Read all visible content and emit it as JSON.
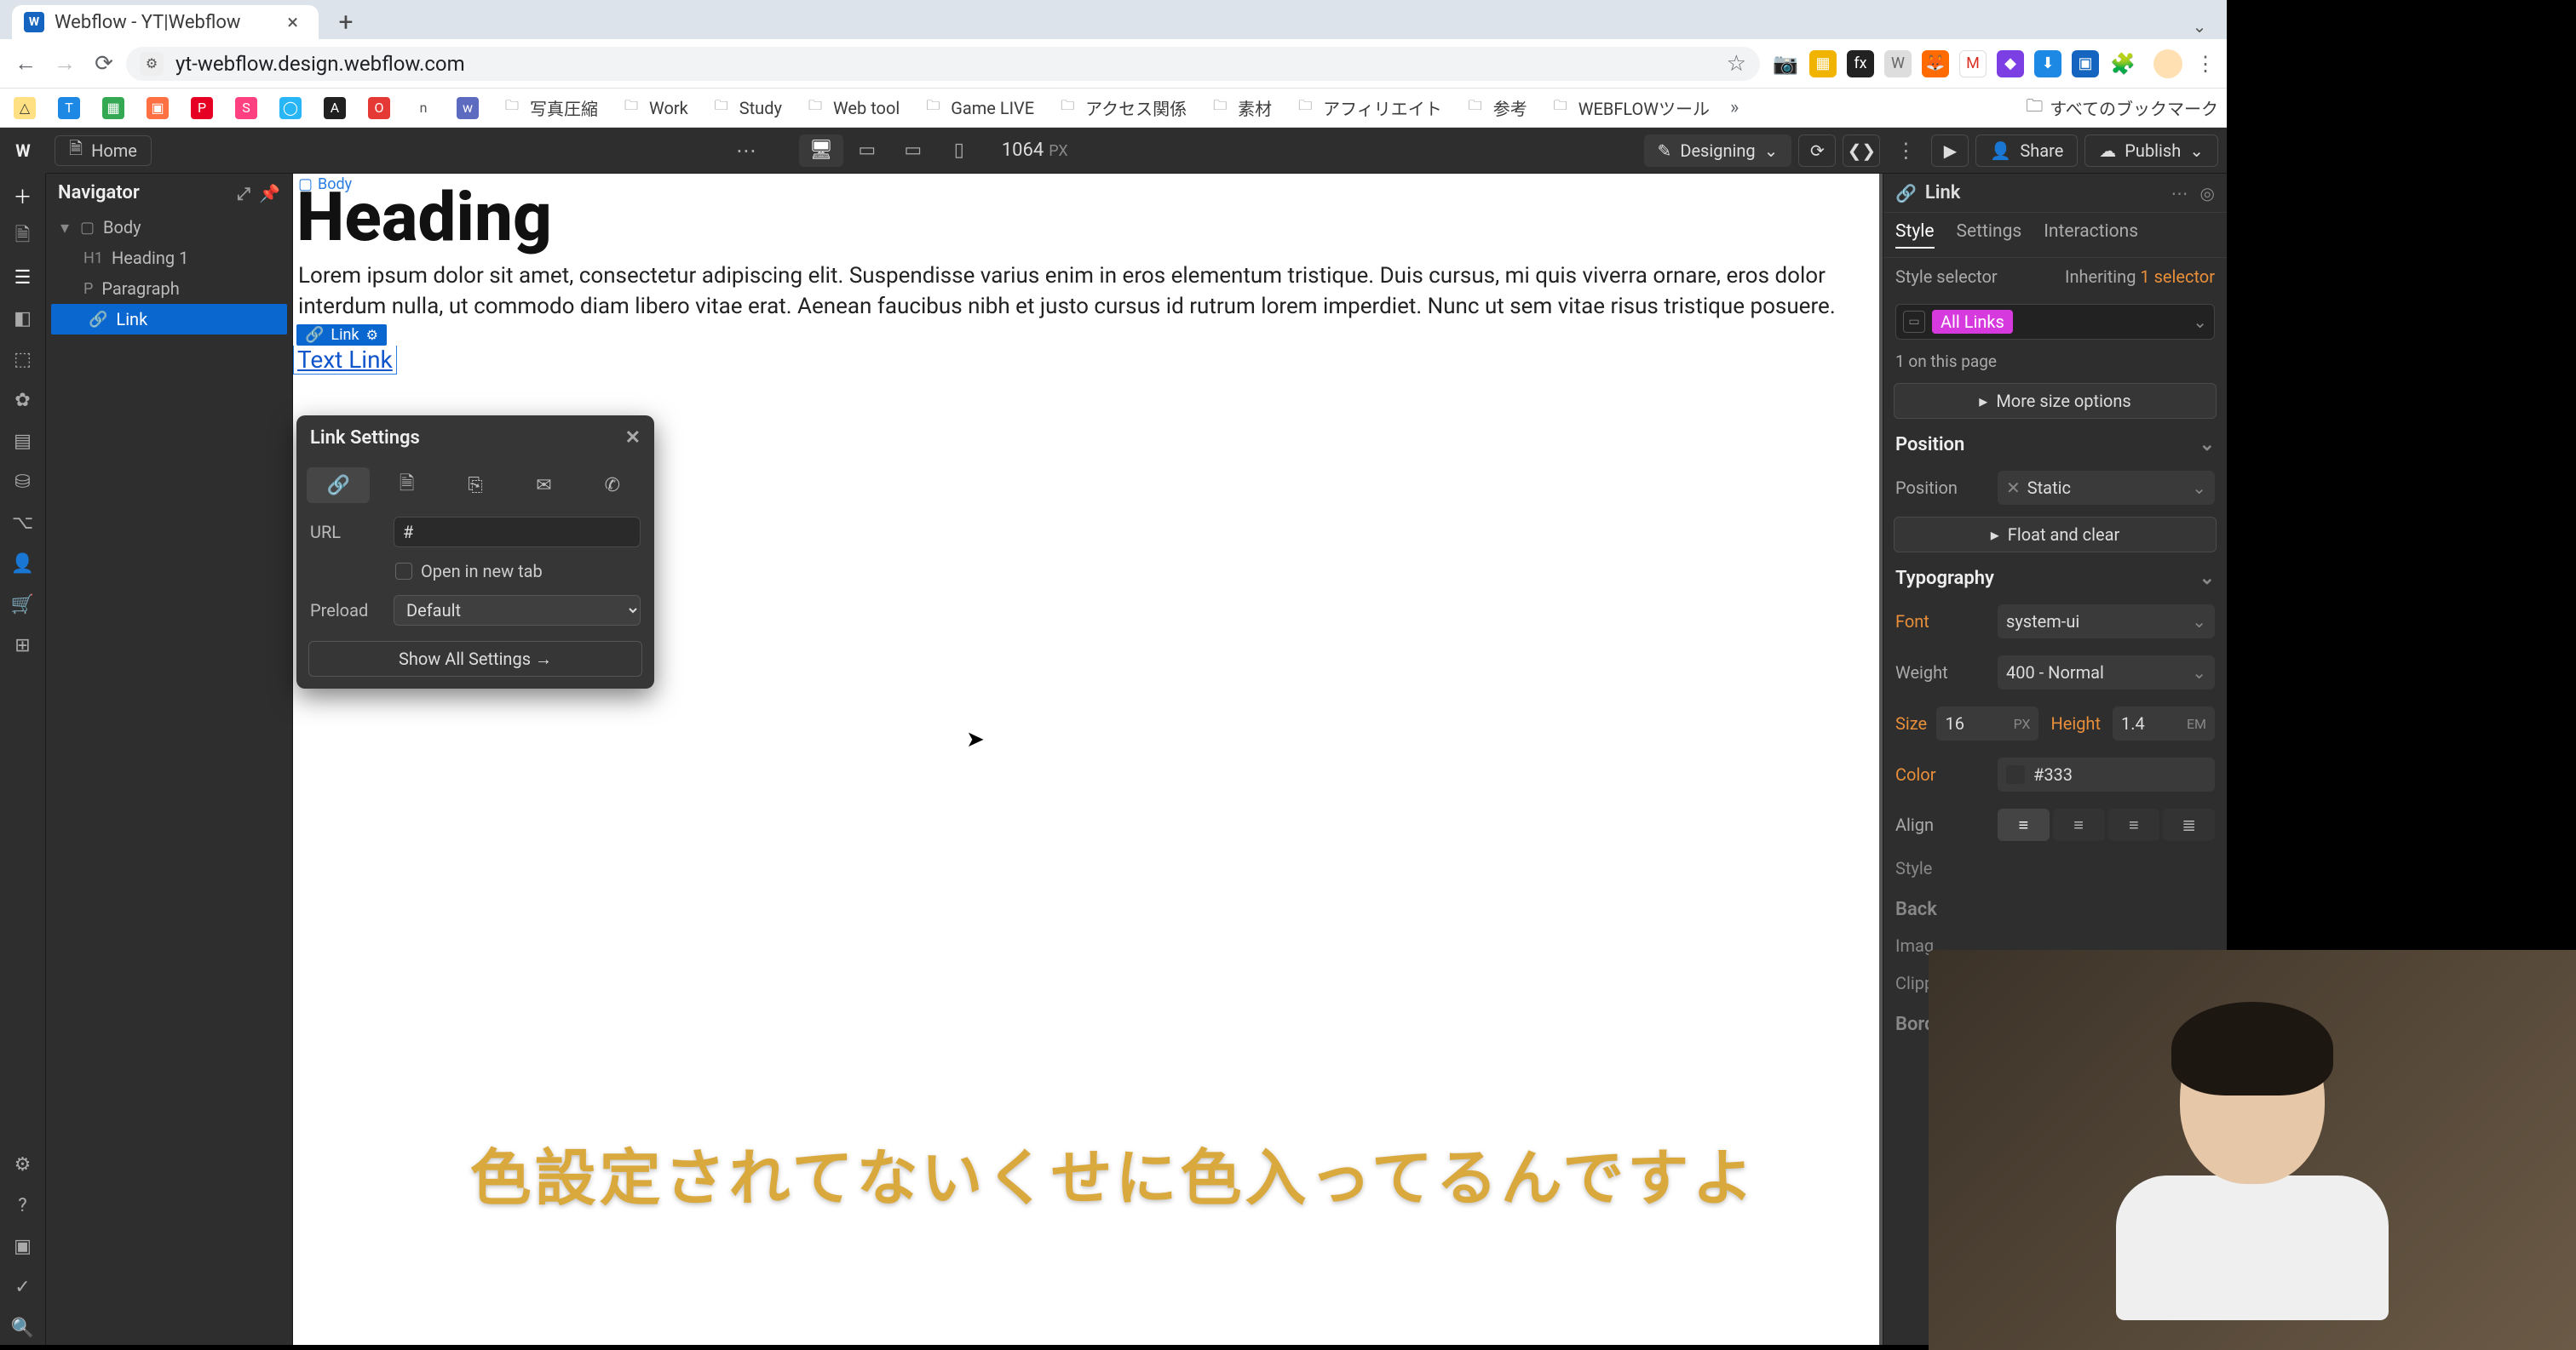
{
  "browser": {
    "tab_title": "Webflow - YT|Webflow",
    "url": "yt-webflow.design.webflow.com",
    "new_tab_tip": "+",
    "bookmarks": [
      {
        "icon": "drive",
        "color": "#f4b400",
        "label": ""
      },
      {
        "icon": "t",
        "color": "#1e88e5",
        "label": ""
      },
      {
        "icon": "g",
        "color": "#34a853",
        "label": ""
      },
      {
        "icon": "sq",
        "color": "#ff7043",
        "label": ""
      },
      {
        "icon": "p",
        "color": "#e60023",
        "label": ""
      },
      {
        "icon": "s",
        "color": "#ff4081",
        "label": ""
      },
      {
        "icon": "c",
        "color": "#29b6f6",
        "label": ""
      },
      {
        "icon": "a",
        "color": "#212121",
        "label": ""
      },
      {
        "icon": "o",
        "color": "#e53935",
        "label": ""
      },
      {
        "icon": "n",
        "color": "#757575",
        "label": ""
      },
      {
        "icon": "w",
        "color": "#5c6bc0",
        "label": ""
      }
    ],
    "folders": [
      "写真圧縮",
      "Work",
      "Study",
      "Web tool",
      "Game LIVE",
      "アクセス関係",
      "素材",
      "アフィリエイト",
      "参考",
      "WEBFLOWツール"
    ],
    "all_bookmarks": "すべてのブックマーク"
  },
  "webflow": {
    "home": "Home",
    "canvas_width": "1064",
    "canvas_unit": "PX",
    "designing": "Designing",
    "share": "Share",
    "publish": "Publish"
  },
  "navigator": {
    "title": "Navigator",
    "items": {
      "body": "Body",
      "h1": "Heading 1",
      "p": "Paragraph",
      "link": "Link"
    }
  },
  "canvas": {
    "body_chip": "Body",
    "heading": "Heading",
    "paragraph": "Lorem ipsum dolor sit amet, consectetur adipiscing elit. Suspendisse varius enim in eros elementum tristique. Duis cursus, mi quis viverra ornare, eros dolor interdum nulla, ut commodo diam libero vitae erat. Aenean faucibus nibh et justo cursus id rutrum lorem imperdiet. Nunc ut sem vitae risus tristique posuere.",
    "sel_chip": "Link",
    "text_link": "Text Link"
  },
  "link_settings": {
    "title": "Link Settings",
    "url_label": "URL",
    "url_value": "#",
    "open_new_tab": "Open in new tab",
    "preload_label": "Preload",
    "preload_value": "Default",
    "show_all": "Show All Settings  →"
  },
  "style": {
    "header": "Link",
    "tabs": {
      "style": "Style",
      "settings": "Settings",
      "interactions": "Interactions"
    },
    "selector_label": "Style selector",
    "inheriting": "Inheriting ",
    "inheriting_count": "1 selector",
    "selector_pill": "All Links",
    "on_page": "1 on this page",
    "more_size": "More size options",
    "position_section": "Position",
    "position_label": "Position",
    "position_value": "Static",
    "float_clear": "Float and clear",
    "typo_section": "Typography",
    "font_label": "Font",
    "font_value": "system-ui",
    "weight_label": "Weight",
    "weight_value": "400 - Normal",
    "size_label": "Size",
    "size_value": "16",
    "size_unit": "PX",
    "height_label": "Height",
    "height_value": "1.4",
    "height_unit": "EM",
    "color_label": "Color",
    "color_value": "#333",
    "align_label": "Align",
    "style_label": "Style",
    "back_label": "Back",
    "imag_label": "Imag",
    "clip_label": "Clipp",
    "bord_label": "Bord"
  },
  "subtitle": "色設定されてないくせに色入ってるんですよ"
}
